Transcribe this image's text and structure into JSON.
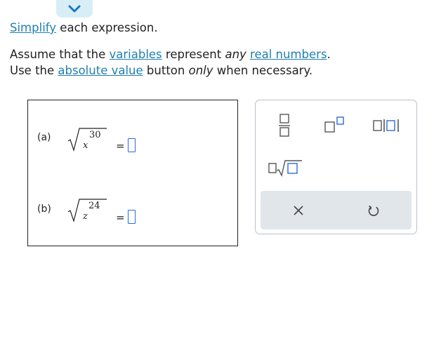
{
  "header": {
    "line1": {
      "link_simplify": "Simplify",
      "rest": " each expression."
    },
    "line2": {
      "t1": "Assume that the ",
      "link_variables": "variables",
      "t2": " represent ",
      "em_any": "any",
      "t3": " ",
      "link_real": "real numbers",
      "t4": "."
    },
    "line3": {
      "t1": "Use the ",
      "link_abs": "absolute value",
      "t2": " button ",
      "em_only": "only",
      "t3": " when necessary."
    }
  },
  "problems": [
    {
      "label": "(a)",
      "radicand_var": "x",
      "exponent": "30",
      "equals": "="
    },
    {
      "label": "(b)",
      "radicand_var": "z",
      "exponent": "24",
      "equals": "="
    }
  ],
  "palette": {
    "buttons": [
      "fraction-button",
      "exponent-button",
      "absolute-value-button",
      "nth-root-button"
    ],
    "actions": [
      "clear-button",
      "undo-button"
    ]
  },
  "colors": {
    "link": "#1f7fb0",
    "answer_box_border": "#2e6bd6",
    "action_bar": "#e1e6ea",
    "tab": "#d8eef7"
  }
}
